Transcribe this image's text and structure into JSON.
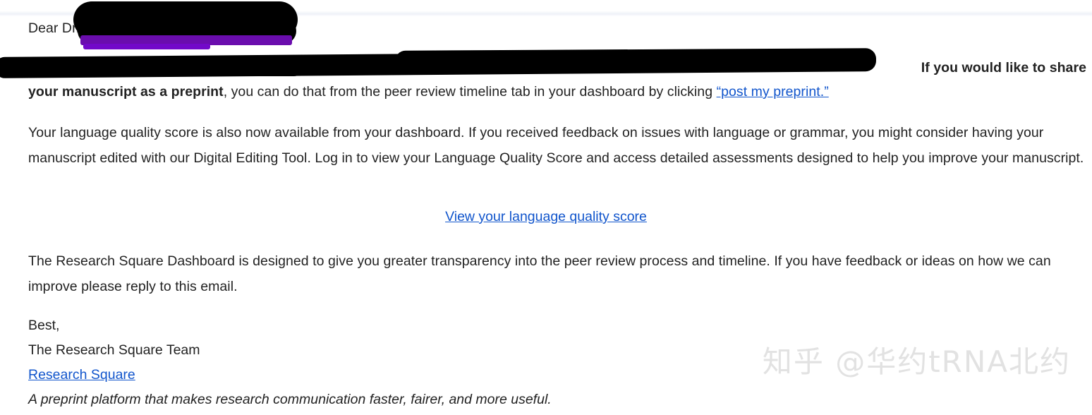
{
  "email": {
    "greeting": "Dear Dr.",
    "preprint_paragraph": {
      "bold_lead": "If you would like to share",
      "bold_continuation": "your manuscript as a preprint",
      "text_after_bold": ", you can do that from the peer review timeline tab in your dashboard by clicking ",
      "link_text": "“post my preprint.”"
    },
    "language_quality_paragraph": "Your language quality score is also now available from your dashboard. If you received feedback on issues with language or grammar, you might consider having your manuscript edited with our Digital Editing Tool. Log in to view your Language Quality Score and access detailed assessments designed to help you improve your manuscript.",
    "cta_link": "View your language quality score",
    "dashboard_paragraph": "The Research Square Dashboard is designed to give you greater transparency into the peer review process and timeline. If you have feedback or ideas on how we can improve please reply to this email.",
    "signature": {
      "closing": "Best,",
      "team": "The Research Square Team",
      "company_link": "Research Square",
      "tagline": "A preprint platform that makes research communication faster, fairer, and more useful."
    }
  },
  "watermark": {
    "text": "知乎 @华约tRNA北约"
  },
  "colors": {
    "link": "#1155cc",
    "text": "#222222",
    "redaction": "#000000",
    "highlight_purple": "#6a0dad",
    "watermark": "#e2e2e2",
    "background": "#ffffff"
  }
}
